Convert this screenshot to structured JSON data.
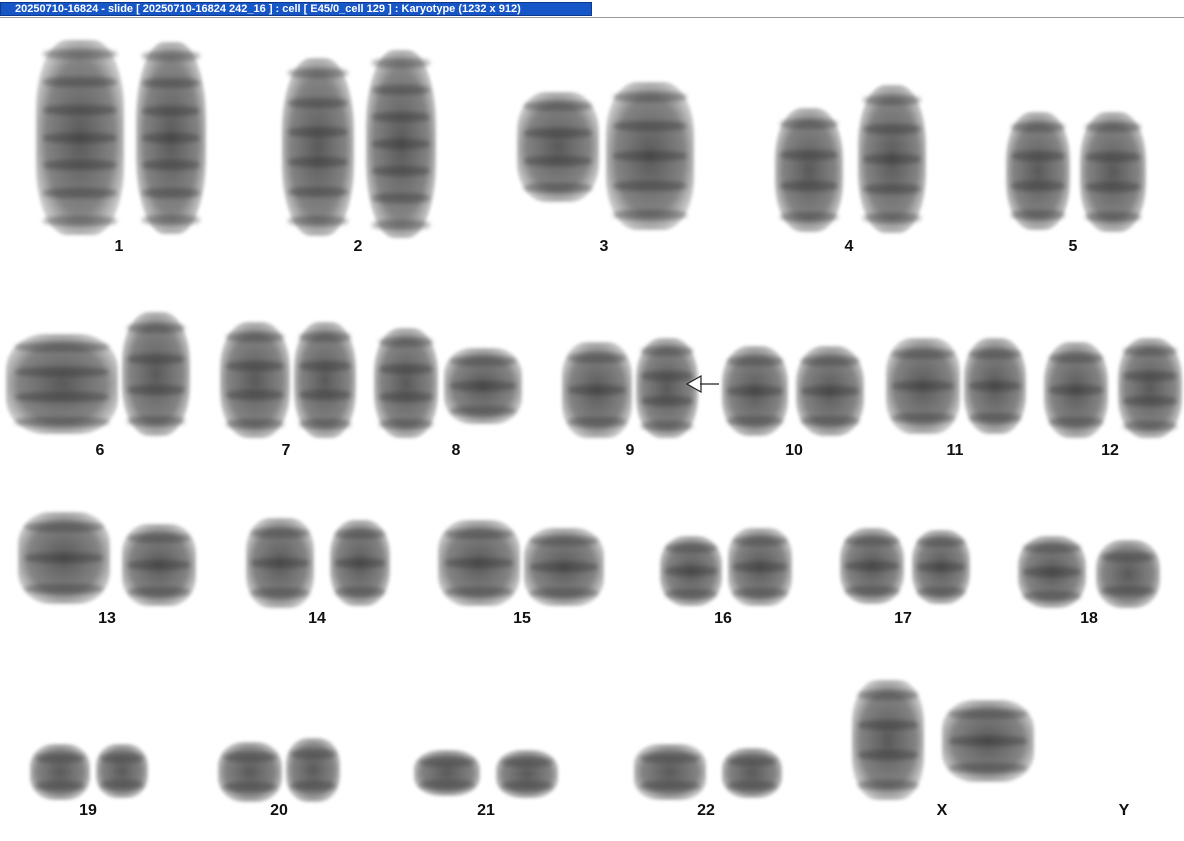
{
  "window": {
    "title": "20250710-16824 - slide [ 20250710-16824 242_16 ] : cell [ E45/0_cell 129 ] : Karyotype  (1232 x 912)"
  },
  "karyogram": {
    "chromosome_labels": [
      "1",
      "2",
      "3",
      "4",
      "5",
      "6",
      "7",
      "8",
      "9",
      "10",
      "11",
      "12",
      "13",
      "14",
      "15",
      "16",
      "17",
      "18",
      "19",
      "20",
      "21",
      "22",
      "X",
      "Y"
    ],
    "annotation": {
      "icon": "arrow-left-icon",
      "points_to": "9"
    }
  }
}
